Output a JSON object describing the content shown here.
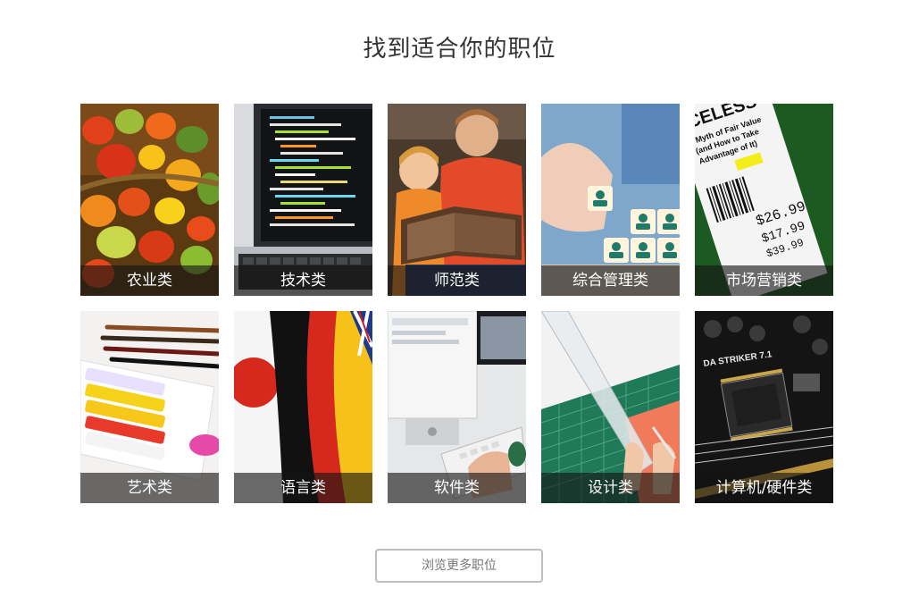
{
  "page": {
    "title": "找到适合你的职位",
    "more_button": "浏览更多职位"
  },
  "categories": [
    {
      "label": "农业类",
      "icon": "vegetables-basket-photo"
    },
    {
      "label": "技术类",
      "icon": "laptop-code-photo"
    },
    {
      "label": "师范类",
      "icon": "father-reading-photo"
    },
    {
      "label": "综合管理类",
      "icon": "people-blocks-photo"
    },
    {
      "label": "市场营销类",
      "icon": "price-tag-photo"
    },
    {
      "label": "艺术类",
      "icon": "paint-tubes-photo"
    },
    {
      "label": "语言类",
      "icon": "flags-photo"
    },
    {
      "label": "软件类",
      "icon": "computer-keyboard-photo"
    },
    {
      "label": "设计类",
      "icon": "cutting-mat-ruler-photo"
    },
    {
      "label": "计算机/硬件类",
      "icon": "circuit-board-photo"
    }
  ],
  "tag_text": {
    "line1": "ICELESS",
    "line2": "e Myth of Fair Value",
    "line3": "(and How to Take",
    "line4": "Advantage of It)",
    "price1": "$26.99",
    "price2": "$17.99",
    "price3": "$39.99",
    "board_text": "DA STRIKER 7.1"
  }
}
